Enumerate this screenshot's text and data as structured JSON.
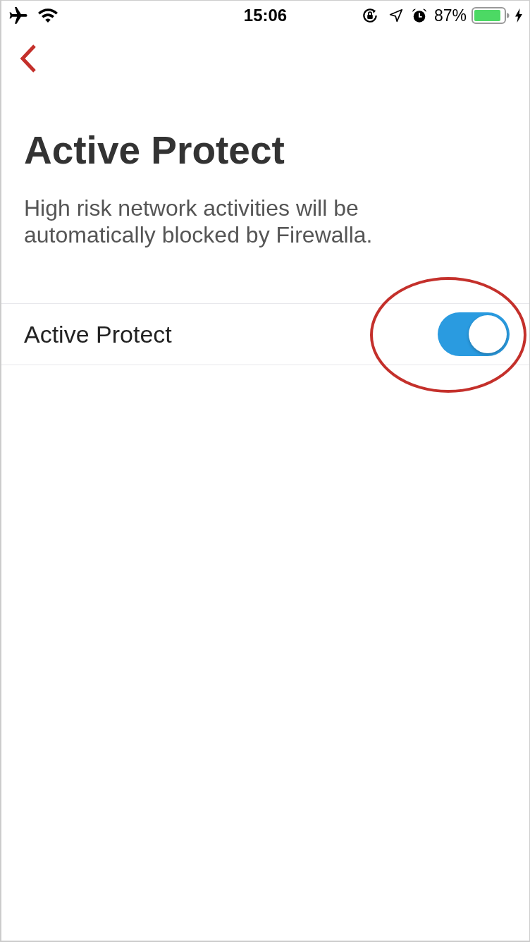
{
  "status_bar": {
    "time": "15:06",
    "battery_percent": "87%"
  },
  "header": {
    "title": "Active Protect",
    "description": "High risk network activities will be automatically blocked by Firewalla."
  },
  "settings": [
    {
      "kind": "toggle",
      "label": "Active Protect",
      "on": true,
      "highlighted": true
    }
  ]
}
